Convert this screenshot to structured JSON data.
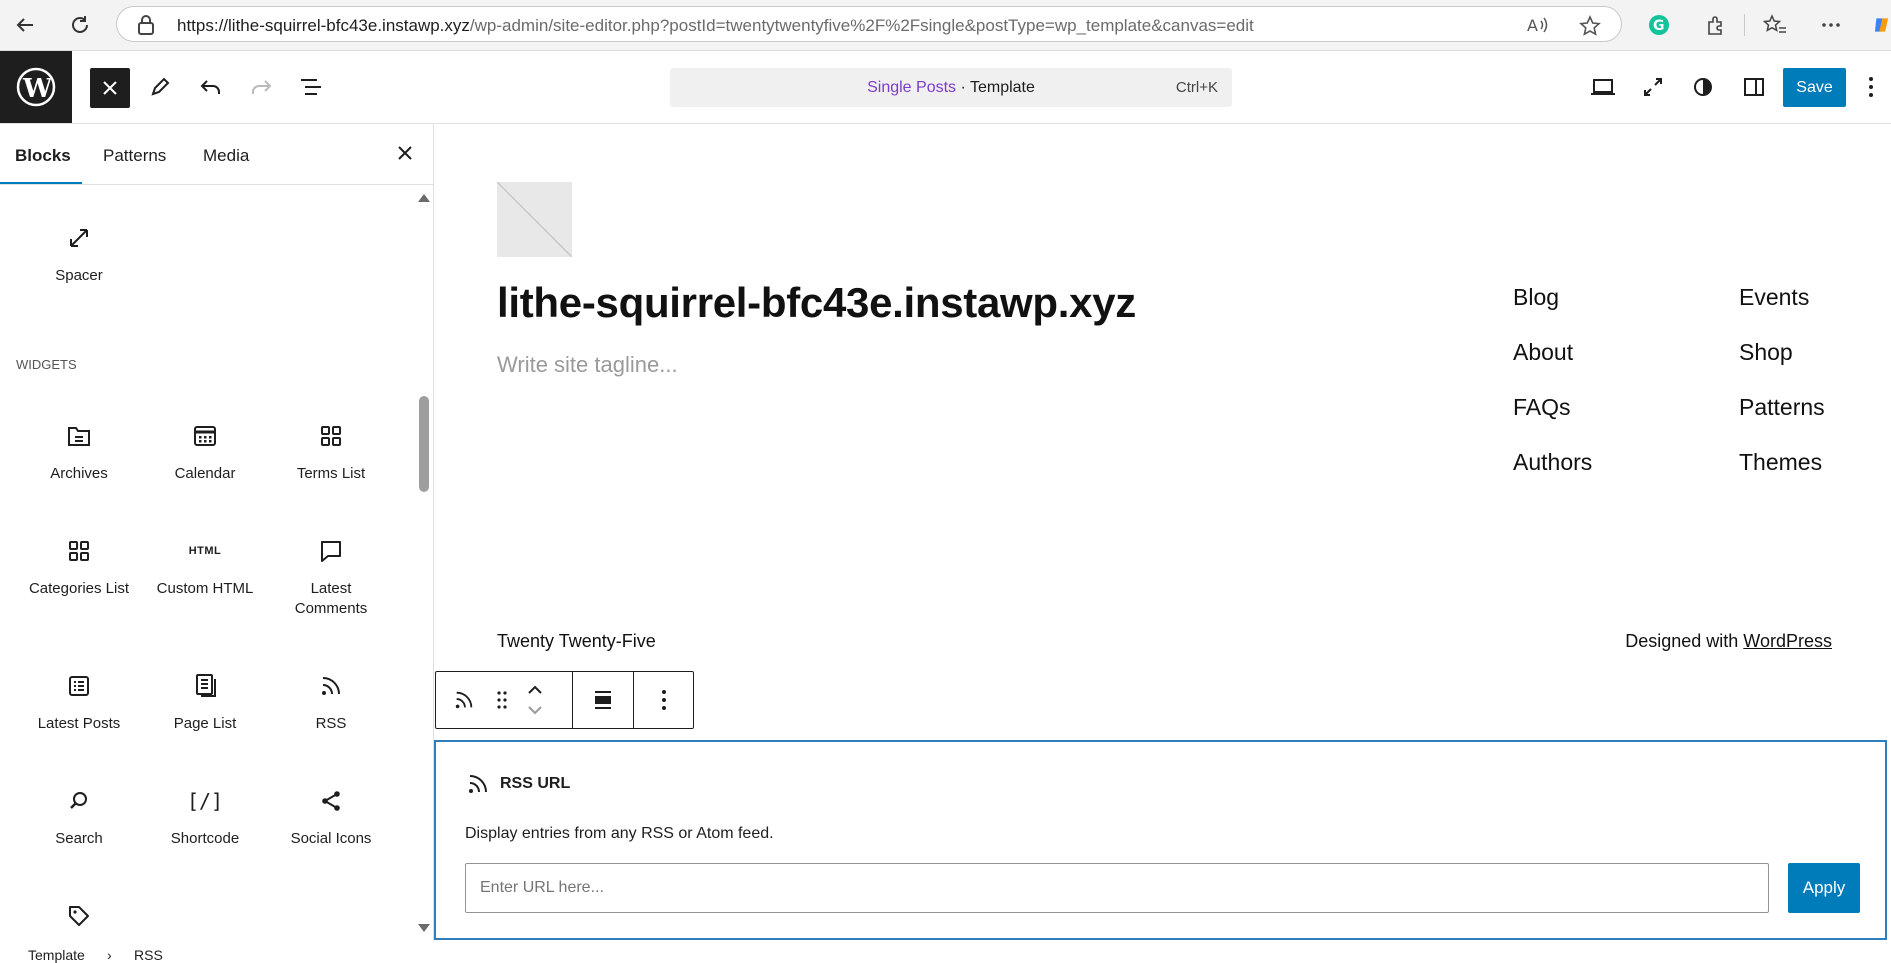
{
  "browser": {
    "url_host": "https://lithe-squirrel-bfc43e.instawp.xyz",
    "url_path": "/wp-admin/site-editor.php?postId=twentytwentyfive%2F%2Fsingle&postType=wp_template&canvas=edit"
  },
  "header": {
    "doc_title": "Single Posts",
    "doc_type": " · Template",
    "shortcut": "Ctrl+K",
    "save_label": "Save"
  },
  "sidebar": {
    "tabs": [
      "Blocks",
      "Patterns",
      "Media"
    ],
    "spacer_label": "Spacer",
    "category": "WIDGETS",
    "widgets": [
      {
        "label": "Archives",
        "icon": "archive-icon"
      },
      {
        "label": "Calendar",
        "icon": "calendar-icon"
      },
      {
        "label": "Terms List",
        "icon": "grid-icon"
      },
      {
        "label": "Categories List",
        "icon": "grid-icon"
      },
      {
        "label": "Custom HTML",
        "icon": "html-icon",
        "glyph": "HTML"
      },
      {
        "label": "Latest Comments",
        "icon": "comment-icon"
      },
      {
        "label": "Latest Posts",
        "icon": "list-icon"
      },
      {
        "label": "Page List",
        "icon": "pages-icon"
      },
      {
        "label": "RSS",
        "icon": "rss-icon"
      },
      {
        "label": "Search",
        "icon": "search-icon"
      },
      {
        "label": "Shortcode",
        "icon": "shortcode-icon",
        "glyph": "[/]"
      },
      {
        "label": "Social Icons",
        "icon": "share-icon"
      }
    ]
  },
  "breadcrumb": [
    "Template",
    "RSS"
  ],
  "canvas": {
    "site_title": "lithe-squirrel-bfc43e.instawp.xyz",
    "tagline": "Write site tagline...",
    "nav": [
      "Blog",
      "Events",
      "About",
      "Shop",
      "FAQs",
      "Patterns",
      "Authors",
      "Themes"
    ],
    "footer_left": "Twenty Twenty-Five",
    "footer_right_prefix": "Designed with ",
    "footer_right_link": "WordPress"
  },
  "rss": {
    "title": "RSS URL",
    "description": "Display entries from any RSS or Atom feed.",
    "placeholder": "Enter URL here...",
    "apply_label": "Apply"
  },
  "colors": {
    "accent": "#007cba",
    "doc_title": "#7a3cc9",
    "selection_border": "#2e7dbd"
  }
}
